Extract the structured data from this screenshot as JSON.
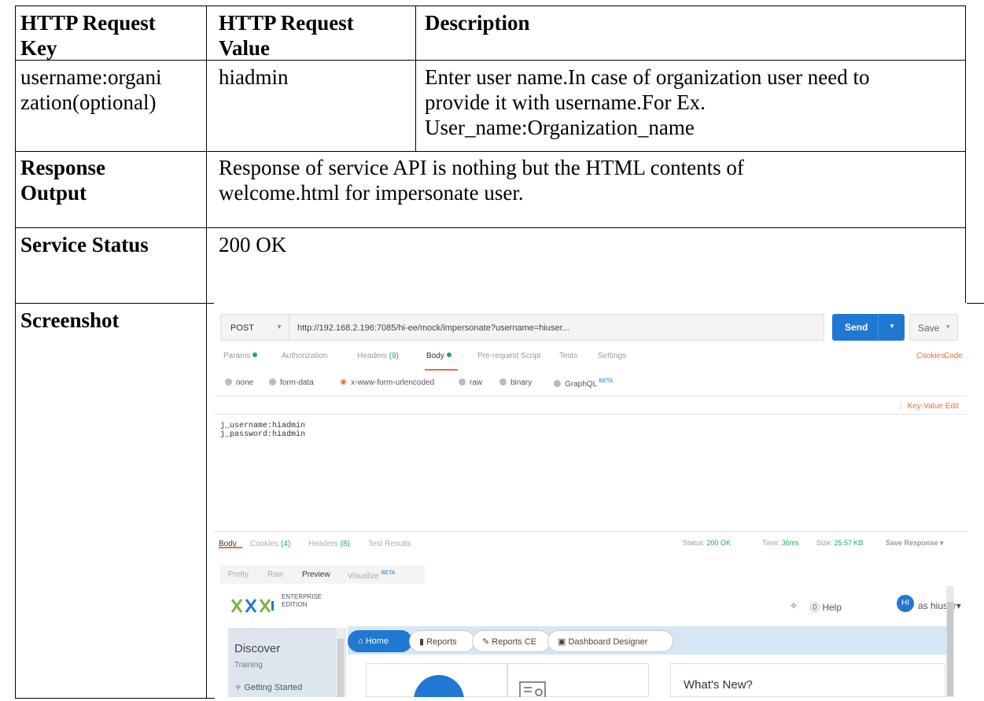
{
  "table": {
    "headers": [
      "HTTP Request Key",
      "HTTP Request Value",
      "Description"
    ],
    "header_lines": [
      [
        "HTTP Request",
        "Key"
      ],
      [
        "HTTP Request",
        "Value"
      ],
      [
        "Description"
      ]
    ],
    "row1": {
      "key_lines": [
        "username:organi",
        "zation(optional)"
      ],
      "value": "hiadmin",
      "description_lines": [
        "Enter user name.In case of organization user need to",
        "provide it with username.For Ex.",
        "User_name:Organization_name"
      ]
    },
    "response_output": {
      "label_lines": [
        "Response",
        "Output"
      ],
      "text_lines": [
        "Response of service API is nothing but the HTML contents of",
        "welcome.html for impersonate user."
      ]
    },
    "service_status": {
      "label": "Service Status",
      "value": "200 OK"
    },
    "screenshot": {
      "label": "Screenshot"
    }
  },
  "screenshot": {
    "method": "POST",
    "url": "http://192.168.2.196:7085/hi-ee/mock/impersonate?username=hiuser...",
    "send_label": "Send",
    "save_label": "Save",
    "request_tabs": [
      {
        "label": "Params",
        "dot": true
      },
      {
        "label": "Authorization"
      },
      {
        "label": "Headers",
        "count": "(9)"
      },
      {
        "label": "Body",
        "dot": true,
        "active": true
      },
      {
        "label": "Pre-request Script"
      },
      {
        "label": "Tests"
      },
      {
        "label": "Settings"
      }
    ],
    "cookies_label": "Cookies",
    "code_label": "Code",
    "body_types": [
      "none",
      "form-data",
      "x-www-form-urlencoded",
      "raw",
      "binary",
      "GraphQL"
    ],
    "body_type_selected": "x-www-form-urlencoded",
    "beta_label": "BETA",
    "key_value_edit": "Key-Value Edit",
    "body_lines": [
      "j_username:hiadmin",
      "j_password:hiadmin"
    ],
    "response_tabs": {
      "body": "Body",
      "cookies": "Cookies",
      "cookies_count": "(4)",
      "headers": "Headers",
      "headers_count": "(8)",
      "test_results": "Test Results"
    },
    "status_label": "Status:",
    "status_value": "200 OK",
    "time_label": "Time:",
    "time_value": "36ms",
    "size_label": "Size:",
    "size_value": "25.57 KB",
    "save_response": "Save Response",
    "view_tabs": [
      "Pretty",
      "Raw",
      "Preview",
      "Visualize"
    ],
    "view_tab_active": "Preview",
    "preview": {
      "edition_lines": [
        "ENTERPRISE",
        "EDITION"
      ],
      "help": "Help",
      "avatar_initials": "HI",
      "user": "as hiuser",
      "discover": "Discover",
      "training": "Training",
      "getting_started": "Getting Started",
      "nav": [
        "Home",
        "Reports",
        "Reports CE",
        "Dashboard Designer"
      ],
      "whats_new": "What's New?"
    },
    "colors": {
      "accent_blue": "#1f78d1",
      "accent_orange": "#f26b3a",
      "status_green": "#26a65b"
    }
  }
}
